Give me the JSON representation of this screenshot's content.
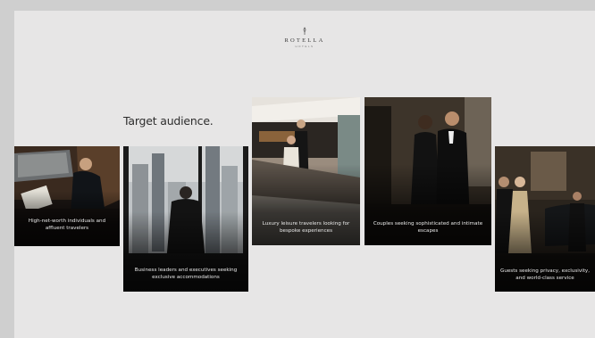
{
  "brand": {
    "name": "ROTELLA",
    "sub": "HOTELS"
  },
  "heading": "Target audience.",
  "cards": [
    {
      "caption": "High-net-worth individuals and affluent travelers",
      "scene": "car-interior-man-reading"
    },
    {
      "caption": "Business leaders and executives seeking exclusive accommodations",
      "scene": "man-at-window-city"
    },
    {
      "caption": "Luxury leisure travelers looking for bespoke experiences",
      "scene": "couple-on-yacht"
    },
    {
      "caption": "Couples seeking sophisticated and intimate escapes",
      "scene": "couple-evening-wear"
    },
    {
      "caption": "Guests seeking privacy, exclusivity, and world-class service",
      "scene": "couple-arriving-by-car"
    }
  ],
  "colors": {
    "background": "#cfcfcf",
    "slide": "#e7e6e6",
    "heading": "#2d2d2d",
    "caption": "#e9e9e9"
  }
}
